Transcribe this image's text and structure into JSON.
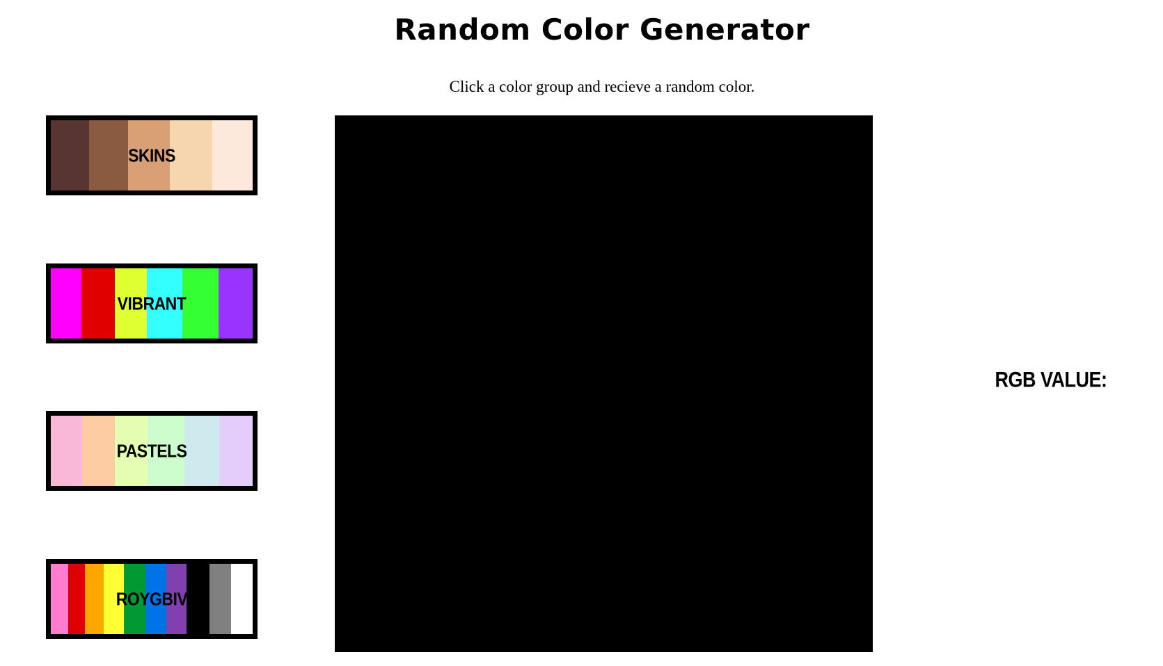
{
  "header": {
    "title": "Random Color Generator",
    "subtitle": "Click a color group and recieve a random color."
  },
  "groups": [
    {
      "label": "SKINS",
      "stripes": [
        {
          "color": "#583432",
          "weight": 58
        },
        {
          "color": "#8a5b40",
          "weight": 58
        },
        {
          "color": "#d9a076",
          "weight": 63
        },
        {
          "color": "#f5d6ae",
          "weight": 64
        },
        {
          "color": "#fde8dc",
          "weight": 61
        }
      ]
    },
    {
      "label": "VIBRANT",
      "stripes": [
        {
          "color": "#ff00ff",
          "weight": 46
        },
        {
          "color": "#e00000",
          "weight": 50
        },
        {
          "color": "#dfff33",
          "weight": 49
        },
        {
          "color": "#33ffff",
          "weight": 53
        },
        {
          "color": "#33ff33",
          "weight": 55
        },
        {
          "color": "#9933ff",
          "weight": 51
        }
      ]
    },
    {
      "label": "PASTELS",
      "stripes": [
        {
          "color": "#f9b9d6",
          "weight": 47
        },
        {
          "color": "#fdcca3",
          "weight": 49
        },
        {
          "color": "#e5fdb2",
          "weight": 50
        },
        {
          "color": "#cdfdcc",
          "weight": 55
        },
        {
          "color": "#cfeaee",
          "weight": 53
        },
        {
          "color": "#e4cdfb",
          "weight": 50
        }
      ]
    },
    {
      "label": "ROYGBIV",
      "stripes": [
        {
          "color": "#ff7ccf",
          "weight": 26
        },
        {
          "color": "#e10000",
          "weight": 26
        },
        {
          "color": "#ffa500",
          "weight": 28
        },
        {
          "color": "#ffff33",
          "weight": 31
        },
        {
          "color": "#009933",
          "weight": 32
        },
        {
          "color": "#0073e6",
          "weight": 32
        },
        {
          "color": "#8040b0",
          "weight": 31
        },
        {
          "color": "#000000",
          "weight": 35
        },
        {
          "color": "#808080",
          "weight": 32
        },
        {
          "color": "#ffffff",
          "weight": 33
        }
      ]
    }
  ],
  "preview": {
    "color": "#000000"
  },
  "rgb": {
    "label": "RGB VALUE:"
  }
}
